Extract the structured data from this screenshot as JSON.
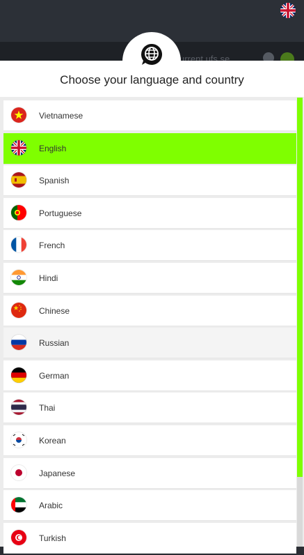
{
  "background": {
    "header_text": "urrent ufs se"
  },
  "modal": {
    "title": "Choose your language and country",
    "icon": "globe-chat-icon",
    "accent_color": "#7fff00",
    "selected_language": "English",
    "languages": [
      {
        "label": "Vietnamese",
        "flag": "vietnam-flag-icon"
      },
      {
        "label": "English",
        "flag": "uk-flag-icon"
      },
      {
        "label": "Spanish",
        "flag": "spain-flag-icon"
      },
      {
        "label": "Portuguese",
        "flag": "portugal-flag-icon"
      },
      {
        "label": "French",
        "flag": "france-flag-icon"
      },
      {
        "label": "Hindi",
        "flag": "india-flag-icon"
      },
      {
        "label": "Chinese",
        "flag": "china-flag-icon"
      },
      {
        "label": "Russian",
        "flag": "russia-flag-icon"
      },
      {
        "label": "German",
        "flag": "germany-flag-icon"
      },
      {
        "label": "Thai",
        "flag": "thailand-flag-icon"
      },
      {
        "label": "Korean",
        "flag": "korea-flag-icon"
      },
      {
        "label": "Japanese",
        "flag": "japan-flag-icon"
      },
      {
        "label": "Arabic",
        "flag": "uae-flag-icon"
      },
      {
        "label": "Turkish",
        "flag": "tunisia-flag-icon"
      }
    ]
  }
}
